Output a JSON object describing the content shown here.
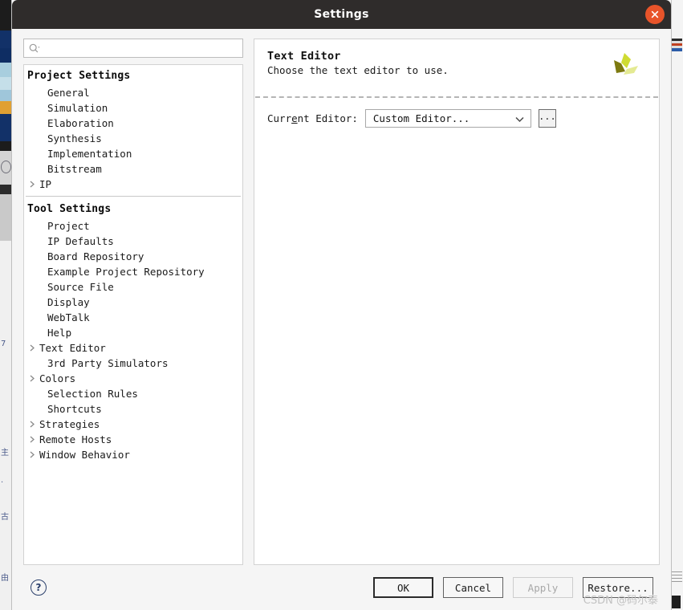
{
  "window": {
    "title": "Settings",
    "close_icon": "close-icon",
    "accent_close": "#e8542a",
    "titlebar_color": "#2f2c2b"
  },
  "search": {
    "placeholder": "",
    "value": "",
    "icon": "search-icon"
  },
  "nav": {
    "groups": [
      {
        "title": "Project Settings",
        "items": [
          {
            "label": "General",
            "expandable": false
          },
          {
            "label": "Simulation",
            "expandable": false
          },
          {
            "label": "Elaboration",
            "expandable": false
          },
          {
            "label": "Synthesis",
            "expandable": false
          },
          {
            "label": "Implementation",
            "expandable": false
          },
          {
            "label": "Bitstream",
            "expandable": false
          },
          {
            "label": "IP",
            "expandable": true
          }
        ]
      },
      {
        "title": "Tool Settings",
        "items": [
          {
            "label": "Project",
            "expandable": false
          },
          {
            "label": "IP Defaults",
            "expandable": false
          },
          {
            "label": "Board Repository",
            "expandable": false
          },
          {
            "label": "Example Project Repository",
            "expandable": false
          },
          {
            "label": "Source File",
            "expandable": false
          },
          {
            "label": "Display",
            "expandable": false
          },
          {
            "label": "WebTalk",
            "expandable": false
          },
          {
            "label": "Help",
            "expandable": false
          },
          {
            "label": "Text Editor",
            "expandable": true
          },
          {
            "label": "3rd Party Simulators",
            "expandable": false
          },
          {
            "label": "Colors",
            "expandable": true
          },
          {
            "label": "Selection Rules",
            "expandable": false
          },
          {
            "label": "Shortcuts",
            "expandable": false
          },
          {
            "label": "Strategies",
            "expandable": true
          },
          {
            "label": "Remote Hosts",
            "expandable": true
          },
          {
            "label": "Window Behavior",
            "expandable": true
          }
        ]
      }
    ]
  },
  "panel": {
    "title": "Text Editor",
    "subtitle": "Choose the text editor to use.",
    "logo_icon": "xilinx-logo-icon",
    "logo_colors": [
      "#7d7a10",
      "#c8d42e",
      "#e3ea8f"
    ],
    "editor": {
      "label_prefix": "Curr",
      "label_underlined": "e",
      "label_suffix": "nt Editor:",
      "value": "Custom Editor...",
      "options": [
        "Custom Editor..."
      ],
      "browse_label": "...",
      "dropdown_icon": "chevron-down-icon"
    }
  },
  "footer": {
    "help_icon": "question-mark-icon",
    "buttons": [
      {
        "label": "OK",
        "state": "focused",
        "accel": ""
      },
      {
        "label": "Cancel",
        "state": "normal",
        "accel": ""
      },
      {
        "label": "Apply",
        "state": "disabled",
        "accel": "A"
      },
      {
        "label": "Restore...",
        "state": "normal",
        "accel": "e"
      }
    ]
  },
  "watermark": {
    "text": "CSDN @码尔泰"
  }
}
